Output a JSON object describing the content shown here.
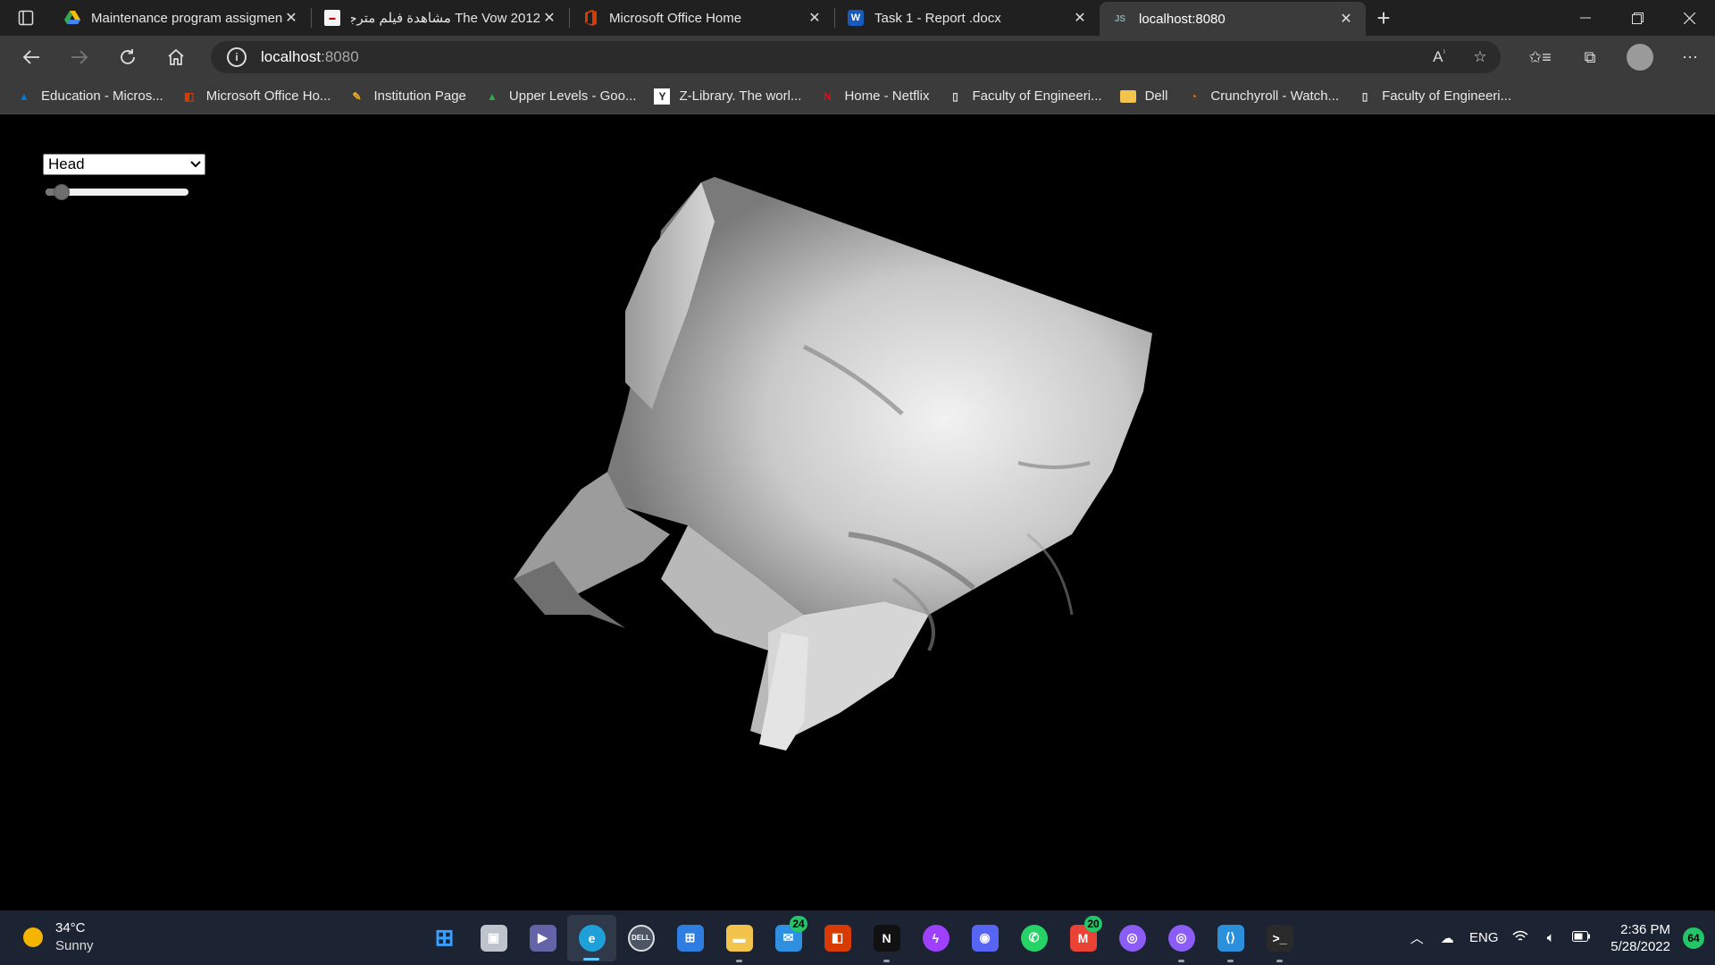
{
  "browser": {
    "tabs": [
      {
        "label": "Maintenance program assigment",
        "icon": "google-drive-icon",
        "active": false
      },
      {
        "label": "The Vow 2012 مشاهدة فيلم مترجم",
        "icon": "site-favicon-icon",
        "active": false
      },
      {
        "label": "Microsoft Office Home",
        "icon": "office-icon",
        "active": false
      },
      {
        "label": "Task 1 - Report .docx",
        "icon": "word-icon",
        "active": false
      },
      {
        "label": "localhost:8080",
        "icon": "js-icon",
        "active": true
      }
    ],
    "new_tab_label": "+",
    "address": {
      "host": "localhost",
      "port": ":8080"
    },
    "bookmarks": [
      {
        "label": "Education - Micros...",
        "icon": "azure-icon",
        "color": "#0078d4"
      },
      {
        "label": "Microsoft Office Ho...",
        "icon": "office-icon",
        "color": "#d83b01"
      },
      {
        "label": "Institution Page",
        "icon": "pencil-icon",
        "color": "#f2b01e"
      },
      {
        "label": "Upper Levels - Goo...",
        "icon": "google-drive-icon",
        "color": "#34a853"
      },
      {
        "label": "Z-Library. The worl...",
        "icon": "zlibrary-icon",
        "color": "#ffffff"
      },
      {
        "label": "Home - Netflix",
        "icon": "netflix-icon",
        "color": "#e50914"
      },
      {
        "label": "Faculty of Engineeri...",
        "icon": "page-icon",
        "color": "#dddddd"
      },
      {
        "label": "Dell",
        "icon": "folder-icon",
        "color": "#f3c44b"
      },
      {
        "label": "Crunchyroll - Watch...",
        "icon": "crunchyroll-icon",
        "color": "#f47521"
      },
      {
        "label": "Faculty of Engineeri...",
        "icon": "page-icon",
        "color": "#dddddd"
      }
    ]
  },
  "viewer": {
    "dataset": "Head",
    "slider_value": 0.08
  },
  "taskbar": {
    "weather": {
      "temp": "34°C",
      "condition": "Sunny"
    },
    "apps": [
      {
        "name": "start-button",
        "icon": "windows-icon",
        "color": "#3aa0ff",
        "running": false,
        "active": false,
        "badge": ""
      },
      {
        "name": "task-view-button",
        "icon": "task-view-icon",
        "color": "#bfc4cc",
        "running": false,
        "active": false,
        "badge": ""
      },
      {
        "name": "teams-chat-button",
        "icon": "teams-chat-icon",
        "color": "#6264a7",
        "running": false,
        "active": false,
        "badge": ""
      },
      {
        "name": "edge-button",
        "icon": "edge-icon",
        "color": "#1fa0d9",
        "running": true,
        "active": true,
        "badge": ""
      },
      {
        "name": "dell-button",
        "icon": "dell-icon",
        "color": "#4b5563",
        "running": false,
        "active": false,
        "badge": ""
      },
      {
        "name": "store-button",
        "icon": "store-icon",
        "color": "#2f7de1",
        "running": false,
        "active": false,
        "badge": ""
      },
      {
        "name": "file-explorer-button",
        "icon": "folder-icon",
        "color": "#f3c44b",
        "running": true,
        "active": false,
        "badge": ""
      },
      {
        "name": "mail-button",
        "icon": "mail-icon",
        "color": "#2f8fe1",
        "running": false,
        "active": false,
        "badge": "24"
      },
      {
        "name": "office-button",
        "icon": "office-icon",
        "color": "#d83b01",
        "running": false,
        "active": false,
        "badge": ""
      },
      {
        "name": "netflix-button",
        "icon": "netflix-icon",
        "color": "#111111",
        "running": true,
        "active": false,
        "badge": ""
      },
      {
        "name": "messenger-button",
        "icon": "messenger-icon",
        "color": "#a040ff",
        "running": false,
        "active": false,
        "badge": ""
      },
      {
        "name": "discord-button",
        "icon": "discord-icon",
        "color": "#5865f2",
        "running": false,
        "active": false,
        "badge": ""
      },
      {
        "name": "whatsapp-button",
        "icon": "whatsapp-icon",
        "color": "#25d366",
        "running": false,
        "active": false,
        "badge": ""
      },
      {
        "name": "gmail-button",
        "icon": "gmail-icon",
        "color": "#ea4335",
        "running": false,
        "active": false,
        "badge": "20"
      },
      {
        "name": "podcast-app-1-button",
        "icon": "podcast-icon",
        "color": "#8b5cf6",
        "running": false,
        "active": false,
        "badge": ""
      },
      {
        "name": "podcast-app-2-button",
        "icon": "podcast-icon",
        "color": "#8b5cf6",
        "running": true,
        "active": false,
        "badge": ""
      },
      {
        "name": "vscode-button",
        "icon": "vscode-icon",
        "color": "#2b8fdc",
        "running": true,
        "active": false,
        "badge": ""
      },
      {
        "name": "terminal-button",
        "icon": "terminal-icon",
        "color": "#2a2a2a",
        "running": true,
        "active": false,
        "badge": ""
      }
    ],
    "tray": {
      "language": "ENG",
      "time": "2:36 PM",
      "date": "5/28/2022",
      "notifications": "64"
    }
  }
}
